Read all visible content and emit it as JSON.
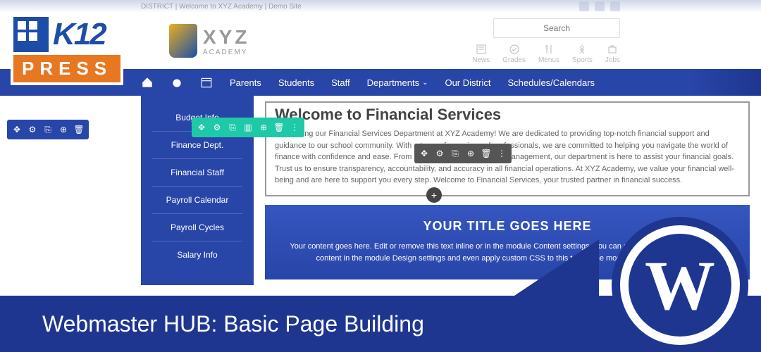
{
  "topbar": {
    "text": "DISTRICT | Welcome to XYZ Academy | Demo Site"
  },
  "header": {
    "logo_main": "XYZ",
    "logo_sub": "ACADEMY",
    "search_placeholder": "Search",
    "quick_links": [
      {
        "label": "News"
      },
      {
        "label": "Grades"
      },
      {
        "label": "Menus"
      },
      {
        "label": "Sports"
      },
      {
        "label": "Jobs"
      }
    ]
  },
  "nav": {
    "items": [
      {
        "label": "Parents"
      },
      {
        "label": "Students"
      },
      {
        "label": "Staff"
      },
      {
        "label": "Departments",
        "dropdown": true
      },
      {
        "label": "Our District"
      },
      {
        "label": "Schedules/Calendars"
      }
    ]
  },
  "sidebar": {
    "items": [
      {
        "label": "Budget Info"
      },
      {
        "label": "Finance Dept."
      },
      {
        "label": "Financial Staff"
      },
      {
        "label": "Payroll Calendar"
      },
      {
        "label": "Payroll Cycles"
      },
      {
        "label": "Salary Info"
      }
    ]
  },
  "content": {
    "title": "Welcome to Financial Services",
    "body": "Introducing our Financial Services Department at XYZ Academy! We are dedicated to providing top-notch financial support and guidance to our school community. With a team of experienced professionals, we are committed to helping you navigate the world of finance with confidence and ease. From budget planning to payroll management, our department is here to assist your financial goals. Trust us to ensure transparency, accountability, and accuracy in all financial operations. At XYZ Academy, we value your financial well-being and are here to support you every step. Welcome to Financial Services, your trusted partner in financial success."
  },
  "cta": {
    "title": "YOUR TITLE GOES HERE",
    "body": "Your content goes here. Edit or remove this text inline or in the module Content settings. You can also style every aspect of this content in the module Design settings and even apply custom CSS to this text in the module Advanced settings."
  },
  "k12": {
    "main": "K12",
    "press": "PRESS"
  },
  "banner": {
    "text": "Webmaster HUB: Basic Page Building"
  }
}
